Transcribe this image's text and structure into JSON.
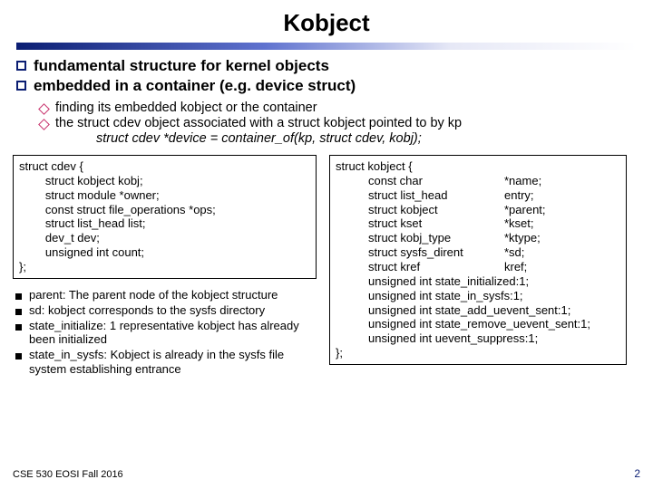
{
  "title": "Kobject",
  "topBullets": [
    "fundamental structure for kernel objects",
    "embedded in a container (e.g. device struct)"
  ],
  "subBullets": [
    "finding its embedded kobject or the container",
    "the struct cdev object associated with a struct kobject pointed to by kp"
  ],
  "inlineCode": "struct cdev *device = container_of(kp, struct cdev, kobj);",
  "leftCode": {
    "open": "struct cdev {",
    "lines": [
      "struct kobject kobj;",
      "struct module *owner;",
      "const struct file_operations *ops;",
      "struct list_head list;",
      "dev_t dev;",
      "unsigned int count;"
    ],
    "close": "};"
  },
  "rightCode": {
    "open": "struct kobject {",
    "pairs": [
      [
        "const char",
        "*name;"
      ],
      [
        "struct list_head",
        "entry;"
      ],
      [
        "struct kobject",
        "*parent;"
      ],
      [
        "struct kset",
        "*kset;"
      ],
      [
        "struct kobj_type",
        "*ktype;"
      ],
      [
        "struct sysfs_dirent",
        "*sd;"
      ],
      [
        "struct kref",
        "kref;"
      ]
    ],
    "tail": [
      "unsigned int state_initialized:1;",
      "unsigned int state_in_sysfs:1;",
      "unsigned int state_add_uevent_sent:1;",
      "unsigned int state_remove_uevent_sent:1;",
      "unsigned int uevent_suppress:1;"
    ],
    "close": "};"
  },
  "notes": [
    "parent: The parent node of the kobject structure",
    "sd: kobject corresponds to the sysfs directory",
    "state_initialize: 1 representative kobject has already been initialized",
    "state_in_sysfs: Kobject is already in the sysfs file system establishing entrance"
  ],
  "footerLeft": "CSE 530 EOSI Fall 2016",
  "footerRight": "2"
}
